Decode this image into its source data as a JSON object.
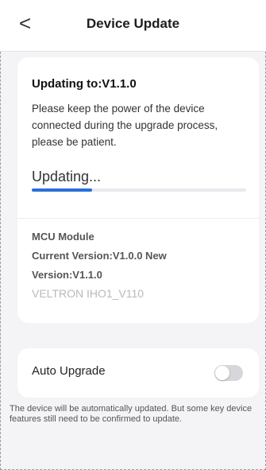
{
  "header": {
    "title": "Device Update",
    "back_icon": "chevron-left-icon",
    "back_glyph": "<"
  },
  "update_card": {
    "title": "Updating to:V1.1.0",
    "description": "Please keep the power of the device connected during the upgrade process, please be patient.",
    "status": "Updating...",
    "progress_fraction": 0.28,
    "module_label": "MCU Module",
    "current_version_line": "Current Version:V1.0.0 New",
    "new_version_line": "Version:V1.1.0",
    "firmware_name": "VELTRON IHO1_V110"
  },
  "auto_upgrade": {
    "label": "Auto Upgrade",
    "enabled": false,
    "note": "The device will be automatically updated. But some key device features still need to be confirmed to update."
  },
  "colors": {
    "accent": "#2a6fdb",
    "toggle_off": "#d7d7db",
    "background": "#f4f4f6"
  }
}
